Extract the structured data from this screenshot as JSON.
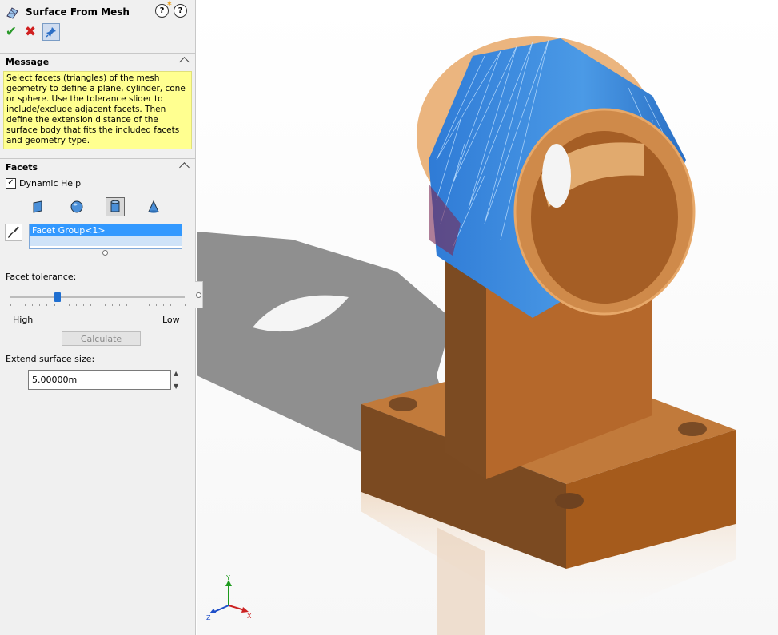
{
  "panel": {
    "title": "Surface From Mesh",
    "icons": {
      "app": "surface-mesh-icon",
      "help": "help-icon",
      "whats_new": "whats-new-icon",
      "ok": "checkmark-icon",
      "cancel": "cancel-icon",
      "pin": "pushpin-icon"
    },
    "message": {
      "header": "Message",
      "text": "Select facets (triangles) of the mesh geometry to define a plane, cylinder, cone or sphere.  Use the tolerance slider to include/exclude adjacent facets.  Then define the extension distance of the surface body that fits the included facets and geometry type."
    },
    "facets": {
      "header": "Facets",
      "dynamic_help_label": "Dynamic Help",
      "dynamic_help_checked": true,
      "types": [
        "plane",
        "sphere",
        "cylinder",
        "cone"
      ],
      "selected_type": "cylinder",
      "list_items": [
        "Facet Group<1>"
      ],
      "tolerance_label": "Facet tolerance:",
      "tolerance_value": 0.27,
      "high_label": "High",
      "low_label": "Low",
      "calculate_label": "Calculate",
      "extend_label": "Extend surface size:",
      "extend_value": "5.00000m"
    }
  },
  "triad": {
    "x": "X",
    "y": "Y",
    "z": "Z"
  },
  "colors": {
    "message_bg": "#ffff90",
    "selection": "#3399ff",
    "part": "#b86a2e",
    "facet_blue": "#3b8fe0"
  }
}
